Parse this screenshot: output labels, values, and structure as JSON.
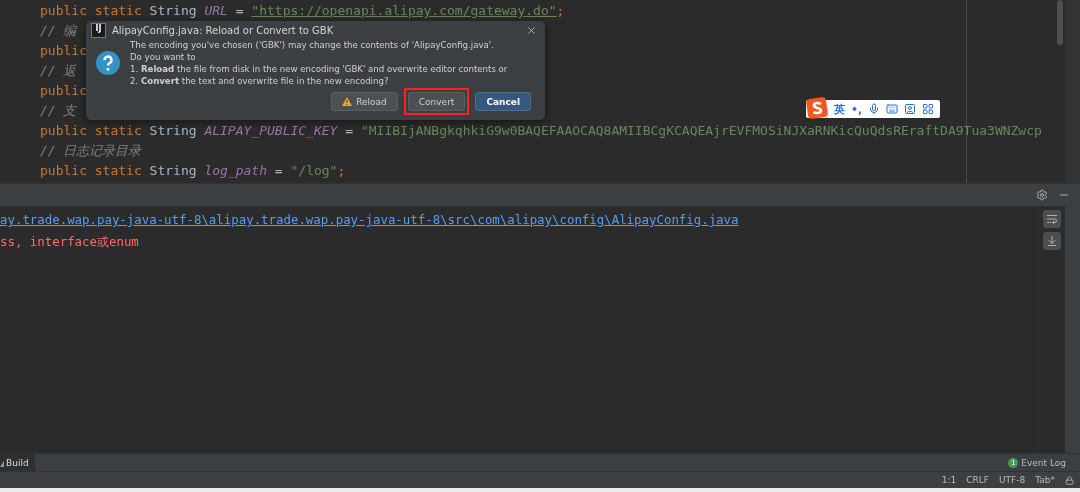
{
  "editor": {
    "lines": [
      {
        "segments": [
          {
            "kind": "keyword",
            "text": "public static "
          },
          {
            "kind": "type",
            "text": "String "
          },
          {
            "kind": "field",
            "text": "URL"
          },
          {
            "kind": "plain",
            "text": " = "
          },
          {
            "kind": "url",
            "text": "\"https://openapi.alipay.com/gateway.do\""
          },
          {
            "kind": "keyword",
            "text": ";"
          }
        ]
      },
      {
        "segments": [
          {
            "kind": "comment",
            "text": "// 编"
          }
        ]
      },
      {
        "segments": [
          {
            "kind": "keyword",
            "text": "public"
          }
        ]
      },
      {
        "segments": [
          {
            "kind": "comment",
            "text": "// 返"
          }
        ]
      },
      {
        "segments": [
          {
            "kind": "keyword",
            "text": "public"
          }
        ]
      },
      {
        "segments": [
          {
            "kind": "comment",
            "text": "// 支"
          }
        ]
      },
      {
        "segments": [
          {
            "kind": "keyword",
            "text": "public static "
          },
          {
            "kind": "type",
            "text": "String "
          },
          {
            "kind": "field",
            "text": "ALIPAY_PUBLIC_KEY"
          },
          {
            "kind": "plain",
            "text": " = "
          },
          {
            "kind": "string",
            "text": "\"MIIBIjANBgkqhkiG9w0BAQEFAAOCAQ8AMIIBCgKCAQEAjrEVFMOSiNJXaRNKicQuQdsREraftDA9Tua3WNZwcp"
          }
        ]
      },
      {
        "segments": [
          {
            "kind": "comment",
            "text": "// 日志记录目录"
          }
        ]
      },
      {
        "segments": [
          {
            "kind": "keyword",
            "text": "public static "
          },
          {
            "kind": "type",
            "text": "String "
          },
          {
            "kind": "field",
            "text": "log_path"
          },
          {
            "kind": "plain",
            "text": " = "
          },
          {
            "kind": "string",
            "text": "\"/log\""
          },
          {
            "kind": "keyword",
            "text": ";"
          }
        ]
      }
    ]
  },
  "dialog": {
    "title": "AlipayConfig.java: Reload or Convert to GBK",
    "app_badge": "IJ",
    "message": [
      "The encoding you've chosen ('GBK') may change the contents of 'AlipayConfig.java'.",
      "Do you want to",
      "1. **Reload** the file from disk in the new encoding 'GBK' and overwrite editor contents or",
      "2. **Convert** the text and overwrite file in the new encoding?"
    ],
    "buttons": [
      {
        "label": "Reload",
        "kind": "warning",
        "highlighted": false
      },
      {
        "label": "Convert",
        "kind": "plain",
        "highlighted": true
      },
      {
        "label": "Cancel",
        "kind": "default",
        "highlighted": false
      }
    ]
  },
  "ime_toolbar": {
    "mode": "英",
    "punctuation": "•,"
  },
  "console": {
    "lines": [
      {
        "kind": "link",
        "text": "ay.trade.wap.pay-java-utf-8\\alipay.trade.wap.pay-java-utf-8\\src\\com\\alipay\\config\\AlipayConfig.java"
      },
      {
        "kind": "error",
        "text": "ss, interface或enum"
      }
    ]
  },
  "tool_strip": {
    "tab": "Build",
    "event_log": {
      "label": "Event Log",
      "badge": "1"
    }
  },
  "status_bar": [
    "1:1",
    "CRLF",
    "UTF-8",
    "Tab*"
  ]
}
